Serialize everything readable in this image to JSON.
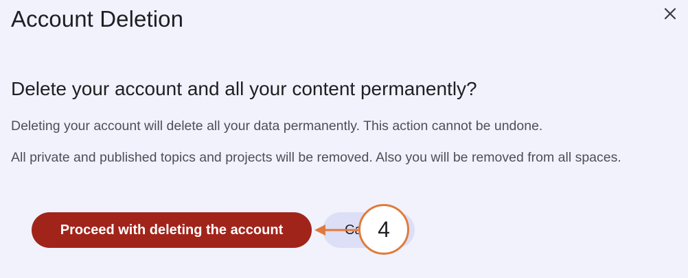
{
  "dialog": {
    "title": "Account Deletion",
    "close_icon": "close-icon",
    "heading": "Delete your account and all your content permanently?",
    "paragraphs": [
      "Deleting your account will delete all your data permanently. This action cannot be undone.",
      "All private and published topics and projects will be removed. Also you will be removed from all spaces."
    ],
    "buttons": {
      "proceed_label": "Proceed with deleting the account",
      "cancel_label": "Ca"
    }
  },
  "annotation": {
    "step_number": "4",
    "color": "#e07a3b"
  },
  "colors": {
    "background": "#f1f2fb",
    "danger": "#a1241b",
    "secondary": "#dcdff5"
  }
}
